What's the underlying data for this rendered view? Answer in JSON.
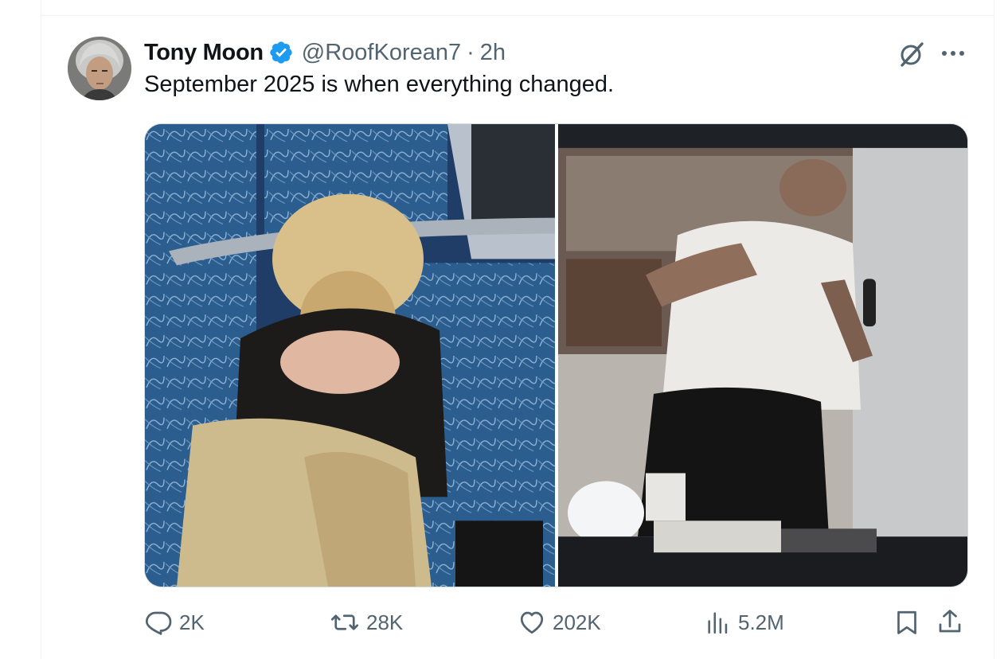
{
  "post": {
    "author": {
      "name": "Tony Moon",
      "handle": "@RoofKorean7",
      "verified": true,
      "avatar": "person-photo"
    },
    "separator": "·",
    "time": "2h",
    "text": "September 2025 is when everything changed.",
    "media": [
      {
        "type": "photo",
        "description_icon": "photo-left"
      },
      {
        "type": "photo",
        "description_icon": "photo-right"
      }
    ]
  },
  "actions": {
    "replies": "2K",
    "reposts": "28K",
    "likes": "202K",
    "views": "5.2M"
  },
  "icons": {
    "reply": "reply-icon",
    "repost": "repost-icon",
    "like": "heart-icon",
    "views": "views-icon",
    "bookmark": "bookmark-icon",
    "share": "share-icon",
    "grok": "grok-icon",
    "more": "more-icon",
    "verified": "verified-badge-icon"
  },
  "colors": {
    "text_primary": "#0f1419",
    "text_secondary": "#536471",
    "verified_blue": "#1d9bf0",
    "border": "#cfd9de"
  }
}
